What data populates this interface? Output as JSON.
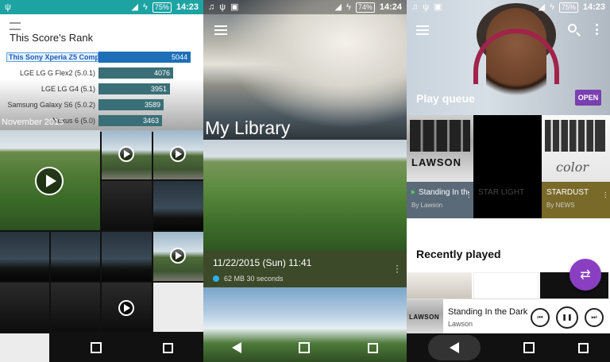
{
  "panel1": {
    "status_time": "14:23",
    "battery": "75%",
    "rank_title": "This Score's Rank",
    "rank_rows": [
      {
        "name": "This Sony Xperia Z5 Comp...",
        "score": "5044",
        "color": "#1e6fb8",
        "fraction": 1.0
      },
      {
        "name": "LGE LG G Flex2 (5.0.1)",
        "score": "4076",
        "color": "#3a6f78",
        "fraction": 0.81
      },
      {
        "name": "LGE LG G4 (5.1)",
        "score": "3951",
        "color": "#3a6f78",
        "fraction": 0.78
      },
      {
        "name": "Samsung Galaxy S6 (5.0.2)",
        "score": "3589",
        "color": "#3a6f78",
        "fraction": 0.71
      },
      {
        "name": "Nexus 6 (5.0)",
        "score": "3463",
        "color": "#3a6f78",
        "fraction": 0.69
      }
    ],
    "month_label": "November 2015"
  },
  "panel2": {
    "status_time": "14:24",
    "battery": "74%",
    "library_title": "My Library",
    "photo_date": "11/22/2015 (Sun) 11:41",
    "photo_meta": "62 MB  30 seconds"
  },
  "panel3": {
    "status_time": "14:23",
    "battery": "75%",
    "play_queue_label": "Play queue",
    "open_label": "OPEN",
    "queue": [
      {
        "title": "Standing In the Dark",
        "artist": "By Lawson",
        "playing": true
      },
      {
        "title": "STAR LIGHT",
        "artist": "",
        "playing": false
      },
      {
        "title": "STARDUST",
        "artist": "By NEWS",
        "playing": false
      }
    ],
    "recently_played_label": "Recently played",
    "now_playing_title": "Standing In the Dark",
    "now_playing_artist": "Lawson",
    "album_logo_text": "LAWSON",
    "album_color_text": "color"
  },
  "colors": {
    "teal_status": "#1ea3a3",
    "accent_purple": "#8a3fc2",
    "lib_info_bg": "#3c4a2a",
    "stardust_meta": "#7a6a2a",
    "lawson_meta": "#5a6a78"
  }
}
